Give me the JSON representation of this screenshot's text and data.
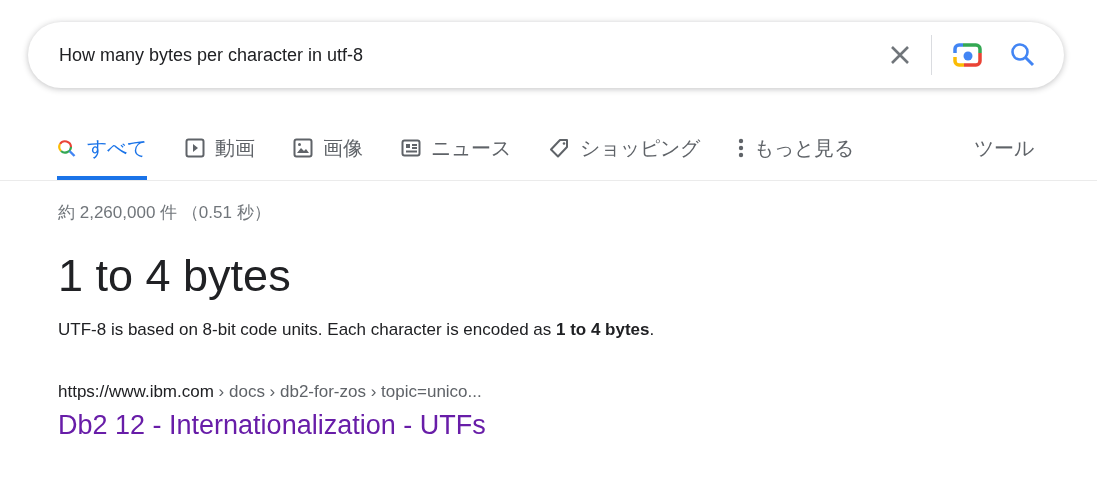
{
  "search": {
    "value": "How many bytes per character in utf-8"
  },
  "tabs": [
    {
      "label": "すべて",
      "kind": "all",
      "selected": true
    },
    {
      "label": "動画",
      "kind": "video",
      "selected": false
    },
    {
      "label": "画像",
      "kind": "image",
      "selected": false
    },
    {
      "label": "ニュース",
      "kind": "news",
      "selected": false
    },
    {
      "label": "ショッピング",
      "kind": "shopping",
      "selected": false
    },
    {
      "label": "もっと見る",
      "kind": "more",
      "selected": false
    }
  ],
  "tools": "ツール",
  "result_stats": "約 2,260,000 件 （0.51 秒）",
  "answer": {
    "heading": "1 to 4 bytes",
    "snippet": "UTF-8 is based on 8-bit code units. Each character is encoded as **1 to 4 bytes**."
  },
  "result": {
    "url_host": "https://www.ibm.com",
    "url_path": " › docs › db2-for-zos › topic=unico...",
    "title": "Db2 12 - Internationalization - UTFs"
  }
}
